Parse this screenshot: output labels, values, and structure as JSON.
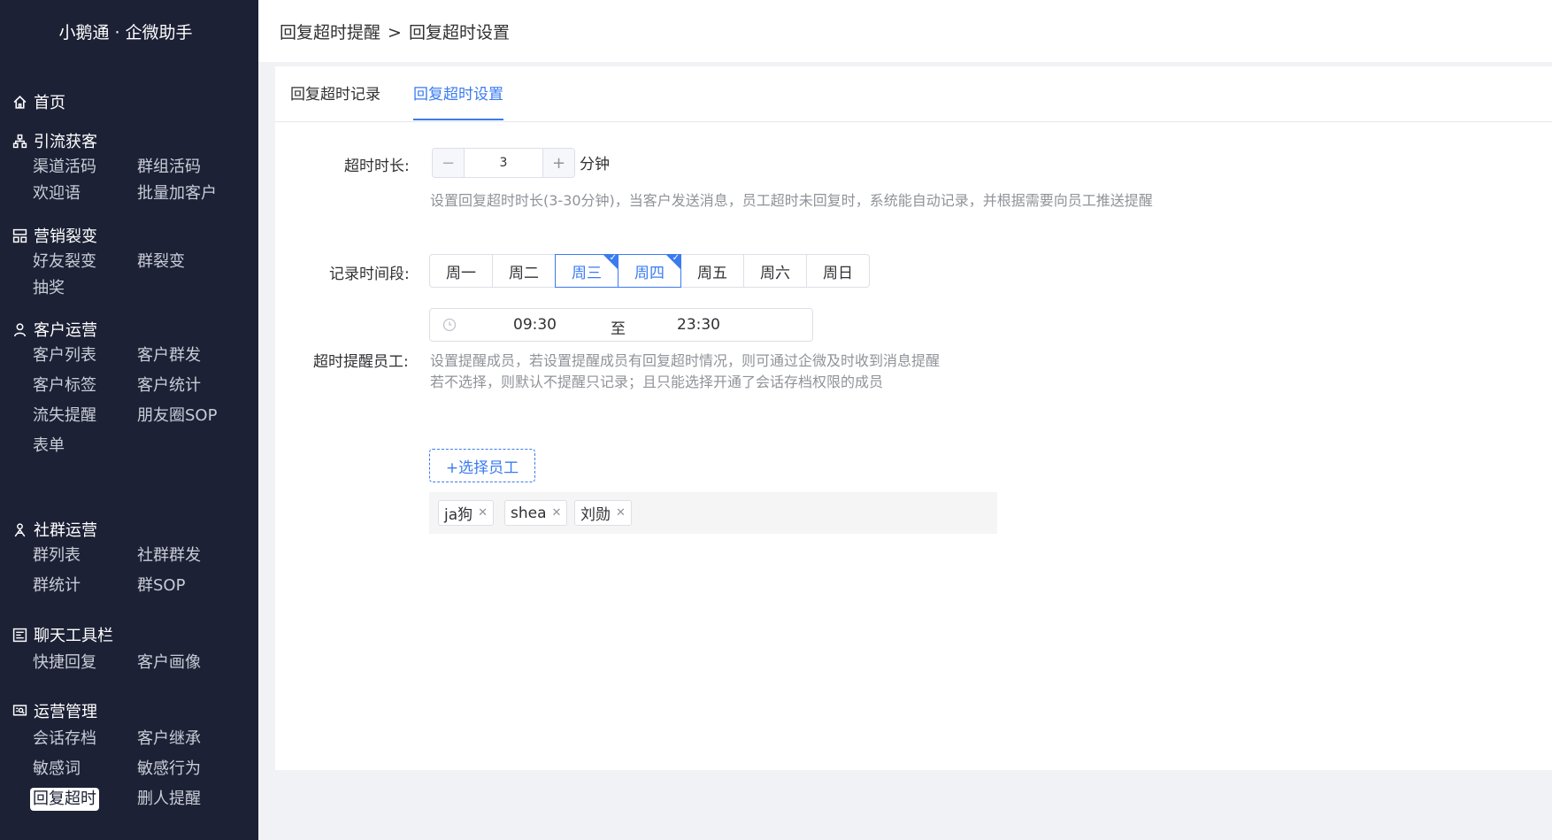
{
  "sidebar": {
    "brand": "小鹅通 · 企微助手",
    "home": "首页",
    "groups": [
      {
        "title": "引流获客",
        "icon": "sitemap-icon",
        "items": [
          "渠道活码",
          "群组活码",
          "欢迎语",
          "批量加客户"
        ]
      },
      {
        "title": "营销裂变",
        "icon": "grid-icon",
        "items": [
          "好友裂变",
          "群裂变",
          "抽奖"
        ]
      },
      {
        "title": "客户运营",
        "icon": "user-icon",
        "items": [
          "客户列表",
          "客户群发",
          "客户标签",
          "客户统计",
          "流失提醒",
          "朋友圈SOP",
          "表单"
        ]
      },
      {
        "title": "社群运营",
        "icon": "group-icon",
        "items": [
          "群列表",
          "社群群发",
          "群统计",
          "群SOP"
        ]
      },
      {
        "title": "聊天工具栏",
        "icon": "toolbar-icon",
        "items": [
          "快捷回复",
          "客户画像"
        ]
      },
      {
        "title": "运营管理",
        "icon": "monitor-search-icon",
        "items": [
          "会话存档",
          "客户继承",
          "敏感词",
          "敏感行为",
          "回复超时",
          "删人提醒"
        ]
      }
    ],
    "active_item": "回复超时"
  },
  "header": {
    "breadcrumb": [
      "回复超时提醒",
      "回复超时设置"
    ],
    "separator": ">"
  },
  "tabs": [
    {
      "label": "回复超时记录",
      "active": false
    },
    {
      "label": "回复超时设置",
      "active": true
    }
  ],
  "form": {
    "timeout": {
      "label": "超时时长:",
      "value": "3",
      "minus": "−",
      "plus": "+",
      "unit": "分钟",
      "hint": "设置回复超时时长(3-30分钟)，当客户发送消息，员工超时未回复时，系统能自动记录，并根据需要向员工推送提醒"
    },
    "period": {
      "label": "记录时间段:",
      "days": [
        {
          "label": "周一",
          "checked": false
        },
        {
          "label": "周二",
          "checked": false
        },
        {
          "label": "周三",
          "checked": true
        },
        {
          "label": "周四",
          "checked": true
        },
        {
          "label": "周五",
          "checked": false
        },
        {
          "label": "周六",
          "checked": false
        },
        {
          "label": "周日",
          "checked": false
        }
      ],
      "start": "09:30",
      "to": "至",
      "end": "23:30"
    },
    "staff": {
      "label": "超时提醒员工:",
      "hint1": "设置提醒成员，若设置提醒成员有回复超时情况，则可通过企微及时收到消息提醒",
      "hint2": "若不选择，则默认不提醒只记录；且只能选择开通了会话存档权限的成员",
      "select_button": "+选择员工",
      "tags": [
        "ja狗",
        "shea",
        "刘勋"
      ]
    }
  },
  "colors": {
    "sidebar_bg": "#1c2135",
    "accent": "#3a7bf0",
    "page_bg": "#f0f2f5"
  }
}
